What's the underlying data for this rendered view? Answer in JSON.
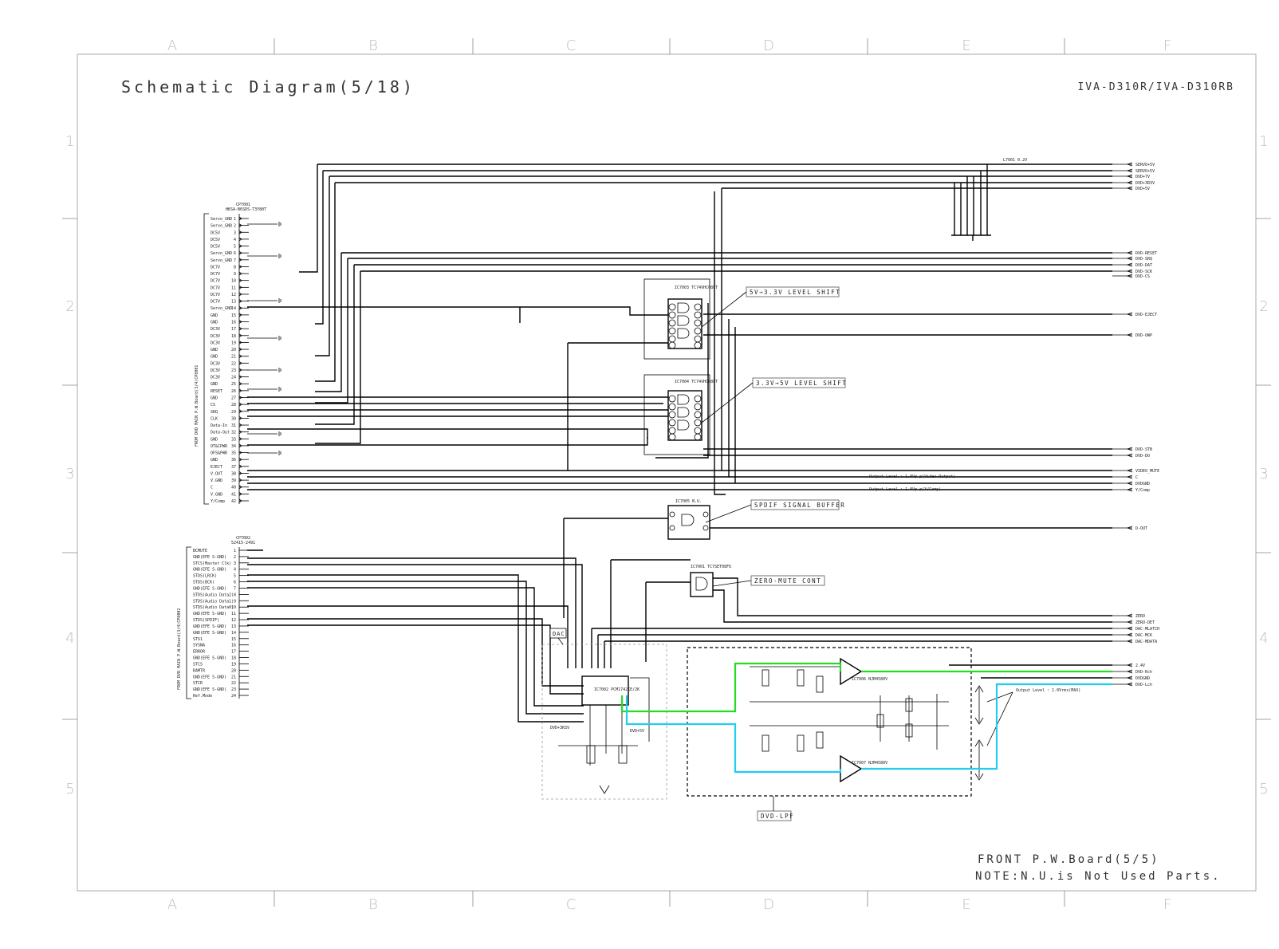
{
  "title": "Schematic Diagram(5/18)",
  "model": "IVA-D310R/IVA-D310RB",
  "grid": {
    "columns": [
      "A",
      "B",
      "C",
      "D",
      "E",
      "F"
    ],
    "rows": [
      "1",
      "2",
      "3",
      "4",
      "5"
    ]
  },
  "footer": {
    "board": "FRONT P.W.Board(5/5)",
    "note": "NOTE:N.U.is Not Used Parts."
  },
  "connectors": {
    "cp7001": {
      "ref": "CP7001",
      "part": "HKSA-B6SDS-T3Y80T",
      "side_label": "FROM DVD MAIN P.W.Board(3/4)CP8001"
    },
    "cp7002": {
      "ref": "CP7002",
      "part": "52415-2491",
      "side_label": "FROM DVD MAIN P.W.Board(3/4)CP8002"
    }
  },
  "cp7001_pins": [
    "Servo_GND",
    "Servo_GND",
    "DC5V",
    "DC5V",
    "DC5V",
    "Servo_GND",
    "Servo_GND",
    "DC7V",
    "DC7V",
    "DC7V",
    "DC7V",
    "DC7V",
    "DC7V",
    "Servo_GND",
    "GND",
    "GND",
    "DC3V",
    "DC3V",
    "DC3V",
    "GND",
    "GND",
    "DC3V",
    "DC3V",
    "DC3V",
    "GND",
    "RESET",
    "GND",
    "CS",
    "SRQ",
    "CLK",
    "Data-In",
    "Data-Out",
    "GND",
    "OT&CPWR",
    "OFS&PWR",
    "GND",
    "EJECT",
    "V.OUT",
    "V.GND",
    "C",
    "V.GND",
    "Y/Comp"
  ],
  "cp7002_pins": [
    "BCMUTE",
    "GND(EFE S-GND)",
    "STCS(Master Clk)",
    "GND(EFE S-GND)",
    "STDS(LRCK)",
    "STDS(BCK)",
    "GND(EFE S-GND)",
    "STDS(Audio Data2)",
    "STDS(Audio Data1)",
    "STDS(Audio Data0)",
    "GND(EFE S-GND)",
    "STDS(SPDIF)",
    "GND(EFE S-GND)",
    "GND(EFE S-GND)",
    "STS1",
    "SYSNA",
    "ERROR",
    "GND(EFE S-GND)",
    "STCS",
    "RAMTR",
    "GND(EFE S-GND)",
    "STCR",
    "GND(EFE S-GND)",
    "Ref.Mode"
  ],
  "right_outputs": [
    "SERVO+5V",
    "SERVO+5V",
    "DVD+7V",
    "DVD+3R3V",
    "DVD+5V",
    "DVD-RESET",
    "DVD-SRQ",
    "DVD-DAT",
    "DVD-SCK",
    "DVD-CS",
    "DVD-EJECT",
    "DVD-OWP",
    "DVD-STB",
    "DVD-DO",
    "VIDEO_MUTE",
    "C",
    "DVDGND",
    "Y/Comp",
    "D-OUT",
    "ZERO",
    "ZERO-DET",
    "DAC-MLATCH",
    "DAC-MCK",
    "DAC-MDATA",
    "2.4V",
    "DVD-Rch",
    "DVDGND",
    "DVD-Lch"
  ],
  "blocks": {
    "level_shift_1": "5V→3.3V LEVEL SHIFT",
    "level_shift_2": "3.3V→5V LEVEL SHIFT",
    "spdif": "SPDIF SIGNAL BUFFER",
    "zero_mute": "ZERO-MUTE CONT",
    "dac": "DAC",
    "lpf": "DVD-LPF"
  },
  "ic_labels": {
    "ic7003": "IC7003 TC74VHC08FT",
    "ic7004": "IC7004 TC74VHC08FT",
    "ic7005": "IC7005 N.U.",
    "ic7001": "IC7001 TC7SET08FU",
    "ic7002": "IC7002 PCM1742KE/2K",
    "ic7006": "IC7006 NJM4580V",
    "ic7007": "IC7007 NJM4580V"
  },
  "annotations": {
    "output_level_1": "Output Level : 1.0Vp-p(Video Output)",
    "output_level_2": "Output Level : 1.0Vp-p(Y/Comp)",
    "output_level_3": "Output Level : 1.0Vrms(MAX)",
    "l7001": "L7001 0.2V",
    "dvd3r3v": "DVD+3R3V",
    "dvd5v": "DVD+5V"
  },
  "highlight_colors": {
    "rch": "#22dd22",
    "lch": "#22ccee"
  }
}
